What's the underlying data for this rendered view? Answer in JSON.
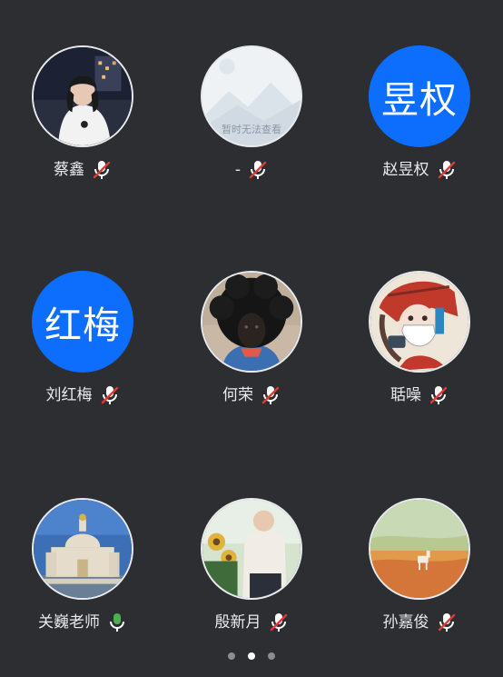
{
  "participants": [
    {
      "name": "蔡鑫",
      "avatar_icon": "photo-woman-night-icon",
      "mic": "muted"
    },
    {
      "name": "-",
      "avatar_icon": "image-unavailable-icon",
      "avatar_caption": "暂时无法查看",
      "mic": "muted"
    },
    {
      "name": "赵昱权",
      "avatar_text": "昱权",
      "avatar_color": "#0d6efd",
      "mic": "muted"
    },
    {
      "name": "刘红梅",
      "avatar_text": "红梅",
      "avatar_color": "#0d6efd",
      "mic": "muted"
    },
    {
      "name": "何荣",
      "avatar_icon": "photo-afro-hair-icon",
      "mic": "muted"
    },
    {
      "name": "聒噪",
      "avatar_icon": "anime-girl-mask-icon",
      "mic": "muted"
    },
    {
      "name": "关巍老师",
      "avatar_icon": "cathedral-photo-icon",
      "mic": "active"
    },
    {
      "name": "殷新月",
      "avatar_icon": "photo-person-sunflowers-icon",
      "mic": "muted"
    },
    {
      "name": "孙嘉俊",
      "avatar_icon": "painting-field-deer-icon",
      "mic": "muted"
    }
  ],
  "pagination": {
    "pages": 3,
    "current": 2
  },
  "colors": {
    "background": "#2c2e31",
    "avatar_blue": "#0d6efd",
    "mic_muted_slash": "#e53935",
    "mic_active": "#4caf50",
    "name_text": "#e9eaed"
  }
}
